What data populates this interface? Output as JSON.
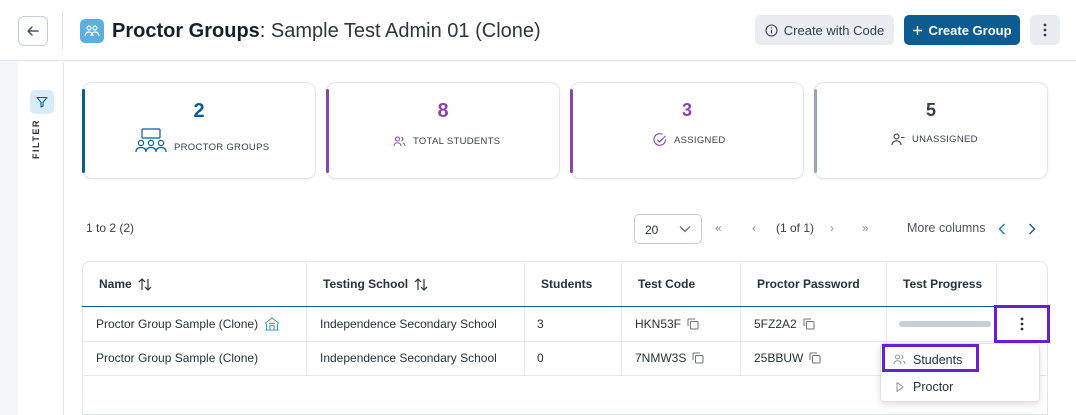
{
  "header": {
    "title_bold": "Proctor Groups",
    "title_sep": ":",
    "title_sub": " Sample Test Admin 01 (Clone)",
    "create_with_code_label": "Create with Code",
    "create_group_label": "Create Group"
  },
  "filter": {
    "label": "FILTER"
  },
  "stats": [
    {
      "value": "2",
      "label": "PROCTOR GROUPS",
      "color": "#0d5c91"
    },
    {
      "value": "8",
      "label": "TOTAL STUDENTS",
      "color": "#8e44ad"
    },
    {
      "value": "3",
      "label": "ASSIGNED",
      "color": "#8e44ad"
    },
    {
      "value": "5",
      "label": "UNASSIGNED",
      "color": "#8a96a8"
    }
  ],
  "pager": {
    "range": "1 to 2 (2)",
    "page_size": "20",
    "page_info": "(1 of 1)",
    "first": "«",
    "prev": "‹",
    "next": "›",
    "last": "»",
    "more_columns": "More columns"
  },
  "table": {
    "columns": [
      "Name",
      "Testing School",
      "Students",
      "Test Code",
      "Proctor Password",
      "Test Progress"
    ],
    "rows": [
      {
        "name": "Proctor Group Sample (Clone)",
        "school": "Independence Secondary School",
        "students": "3",
        "code": "HKN53F",
        "password": "5FZ2A2"
      },
      {
        "name": "Proctor Group Sample (Clone)",
        "school": "Independence Secondary School",
        "students": "0",
        "code": "7NMW3S",
        "password": "25BBUW"
      }
    ]
  },
  "menu": {
    "items": [
      "Students",
      "Proctor"
    ]
  },
  "colors": {
    "accent": "#0d5c91",
    "highlight": "#6a1fd1",
    "purple": "#8e44ad"
  }
}
